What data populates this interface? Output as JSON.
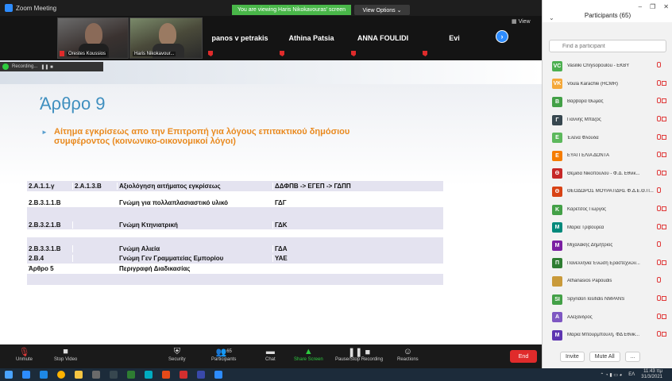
{
  "window": {
    "title": "Zoom Meeting",
    "banner": "You are viewing Haris Nikokavouras' screen",
    "view_options": "View Options ⌄",
    "view": "View"
  },
  "videos": [
    {
      "name": "Orestes Koussios"
    },
    {
      "name": "Haris Nikokavour..."
    }
  ],
  "tiles": [
    "panos v petrakis",
    "Athina Patsia",
    "ANNA FOULIDI",
    "Evi"
  ],
  "recording": {
    "label": "Recording...",
    "controls": "❚❚  ■"
  },
  "slide": {
    "title": "Άρθρο 9",
    "bullet": "Αίτημα εγκρίσεως απο την Επιτροπή για λόγους επιτακτικού δημόσιου συμφέροντος (κοινωνικο-οικονομικοί λόγοι)",
    "rows": [
      {
        "a": "2.Α.1.1.γ",
        "b": "2.Α.1.3.Β",
        "c": "Αξιολόγηση αιτήματος εγκρίσεως",
        "d": "ΔΔΦΠΒ -> ΕΓΕΠ -> ΓΔΠΠ"
      },
      {
        "a": "2.Β.3.1.1.Β",
        "b": "",
        "c": "Γνώμη για πολλαπλασιαστικό υλικό",
        "d": "ΓΔΓ"
      },
      {
        "a": "2.Β.3.2.1.Β",
        "b": "",
        "c": "Γνώμη Κτηνιατρική",
        "d": "ΓΔΚ"
      },
      {
        "a": "2.Β.3.3.1.Β",
        "b": "",
        "c": "Γνώμη Αλιεία",
        "d": "ΓΔΑ"
      },
      {
        "a": "2.Β.4",
        "b": "",
        "c": "Γνώμη Γεν Γραμματείας Εμπορίου",
        "d": "ΥΑΕ"
      },
      {
        "a": "Άρθρο 5",
        "b": "",
        "c": "Περιγραφή Διαδικασίας",
        "d": ""
      }
    ]
  },
  "toolbar": {
    "unmute": "Unmute",
    "stop_video": "Stop Video",
    "security": "Security",
    "participants": "Participants",
    "participants_count": "65",
    "chat": "Chat",
    "share": "Share Screen",
    "pause": "Pause/Stop Recording",
    "reactions": "Reactions",
    "end": "End"
  },
  "panel": {
    "title": "Participants (65)",
    "search_placeholder": "Find a participant",
    "invite": "Invite",
    "mute_all": "Mute All",
    "more": "..."
  },
  "participants": [
    {
      "initials": "VC",
      "name": "Vasiliki Chrysopoulou - ΕΚΒΥ",
      "color": "#4caf50",
      "video": false
    },
    {
      "initials": "VK",
      "name": "Voula Karachle (HCMR)",
      "color": "#f4a83a",
      "video": true
    },
    {
      "initials": "Β",
      "name": "Βαρβάρα Θωμάς",
      "color": "#43a047",
      "video": true
    },
    {
      "initials": "Γ",
      "name": "Γιάννης Μπαζός",
      "color": "#37474f",
      "video": true
    },
    {
      "initials": "Ε",
      "name": "Έλενα Φλούδα",
      "color": "#5cb85c",
      "video": true
    },
    {
      "initials": "Ε",
      "name": "ΕΥΑΓΓΕΛΙΑ ΔΟΝΤΑ",
      "color": "#f57c00",
      "video": true
    },
    {
      "initials": "Θ",
      "name": "Θέμιδα Νικοπούλου - Φ.Δ. Εθνικ...",
      "color": "#c62828",
      "video": true
    },
    {
      "initials": "Θ",
      "name": "ΘΕΟΔΩΡΟΣ ΜΟΥΡΑΤΙΔΗΣ Φ.Δ.Ε.Θ.Π...",
      "color": "#d84315",
      "video": false
    },
    {
      "initials": "Κ",
      "name": "Καρέτσος Γιώργος",
      "color": "#43a047",
      "video": true
    },
    {
      "initials": "Μ",
      "name": "Μαρία Τριβουρέα",
      "color": "#00897b",
      "video": true
    },
    {
      "initials": "Μ",
      "name": "Μιχαλάκης Δημήτριος",
      "color": "#7b1fa2",
      "video": false
    },
    {
      "initials": "Π",
      "name": "Πανελλήνια Ένωση Εραστεχνών...",
      "color": "#2e7d32",
      "video": true
    },
    {
      "initials": "",
      "name": "Athanasios Papoudis",
      "color": "#c99a3a",
      "video": false
    },
    {
      "initials": "SI",
      "name": "Spyridon Iosifidis NMPANS",
      "color": "#43a047",
      "video": true
    },
    {
      "initials": "Α",
      "name": "Αλέξανδρος",
      "color": "#7e57c2",
      "video": true
    },
    {
      "initials": "Μ",
      "name": "Μαρία Μπουρμπούλη, ΦΔ Εθνικ...",
      "color": "#5e35b1",
      "video": true
    }
  ],
  "taskbar": {
    "time": "11:43 πμ",
    "date": "31/3/2021",
    "lang": "ΕΛ"
  }
}
